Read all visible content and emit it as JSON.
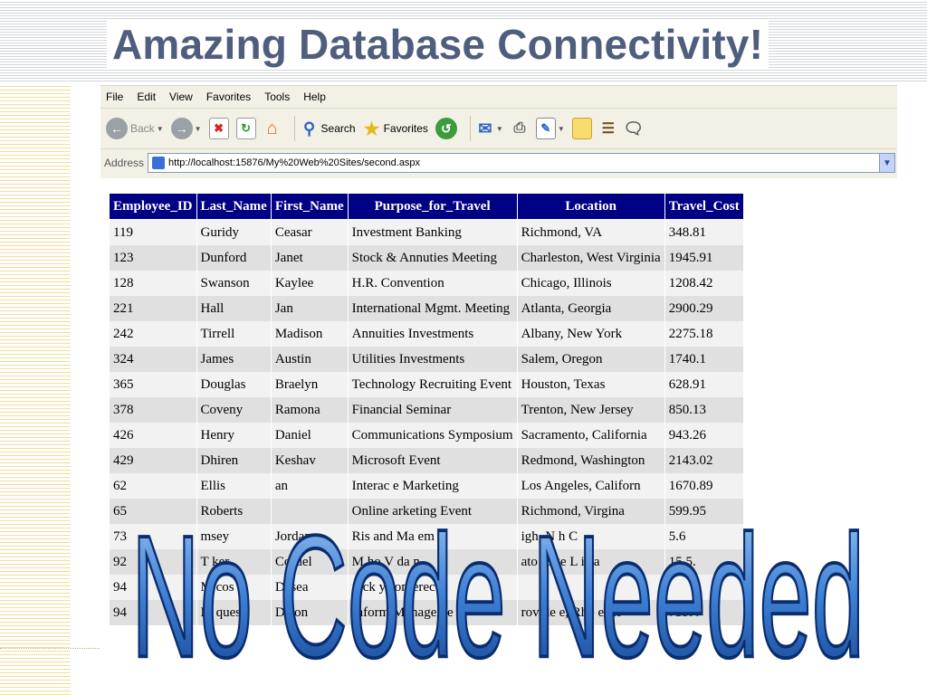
{
  "slide": {
    "title": "Amazing Database Connectivity!",
    "wordart_text": "No Code Needed"
  },
  "browser": {
    "menu": [
      "File",
      "Edit",
      "View",
      "Favorites",
      "Tools",
      "Help"
    ],
    "toolbar": {
      "back_label": "Back",
      "search_label": "Search",
      "favorites_label": "Favorites"
    },
    "address": {
      "label": "Address",
      "url": "http://localhost:15876/My%20Web%20Sites/second.aspx"
    }
  },
  "grid": {
    "columns": [
      "Employee_ID",
      "Last_Name",
      "First_Name",
      "Purpose_for_Travel",
      "Location",
      "Travel_Cost"
    ],
    "rows": [
      [
        "119",
        "Guridy",
        "Ceasar",
        "Investment Banking",
        "Richmond, VA",
        "348.81"
      ],
      [
        "123",
        "Dunford",
        "Janet",
        "Stock & Annuties Meeting",
        "Charleston, West Virginia",
        "1945.91"
      ],
      [
        "128",
        "Swanson",
        "Kaylee",
        "H.R. Convention",
        "Chicago, Illinois",
        "1208.42"
      ],
      [
        "221",
        "Hall",
        "Jan",
        "International Mgmt. Meeting",
        "Atlanta, Georgia",
        "2900.29"
      ],
      [
        "242",
        "Tirrell",
        "Madison",
        "Annuities Investments",
        "Albany, New York",
        "2275.18"
      ],
      [
        "324",
        "James",
        "Austin",
        "Utilities Investments",
        "Salem, Oregon",
        "1740.1"
      ],
      [
        "365",
        "Douglas",
        "Braelyn",
        "Technology Recruiting Event",
        "Houston, Texas",
        "628.91"
      ],
      [
        "378",
        "Coveny",
        "Ramona",
        "Financial Seminar",
        "Trenton, New Jersey",
        "850.13"
      ],
      [
        "426",
        "Henry",
        "Daniel",
        "Communications Symposium",
        "Sacramento, California",
        "943.26"
      ],
      [
        "429",
        "Dhiren",
        "Keshav",
        "Microsoft Event",
        "Redmond, Washington",
        "2143.02"
      ],
      [
        "62",
        "Ellis",
        "an",
        "Interac e Marketing",
        "Los Angeles, Californ",
        "1670.89"
      ],
      [
        "65",
        "Roberts",
        "",
        "Online arketing Event",
        "Richmond, Virgina",
        "599.95"
      ],
      [
        "73",
        "msey",
        "Jordan",
        "Ris and Ma em t",
        "igh, N h C",
        "5.6"
      ],
      [
        "92",
        "T ker",
        "Cordel",
        "M ho V da n",
        "ato R ge L isia",
        "15 5."
      ],
      [
        "94",
        "M cos",
        "Desea",
        "S ck ys onferec",
        "",
        ""
      ],
      [
        "94",
        "M ques",
        "Da on",
        "Inform Manageme",
        "rovide e, Rho e Isl",
        "759.4"
      ]
    ]
  }
}
